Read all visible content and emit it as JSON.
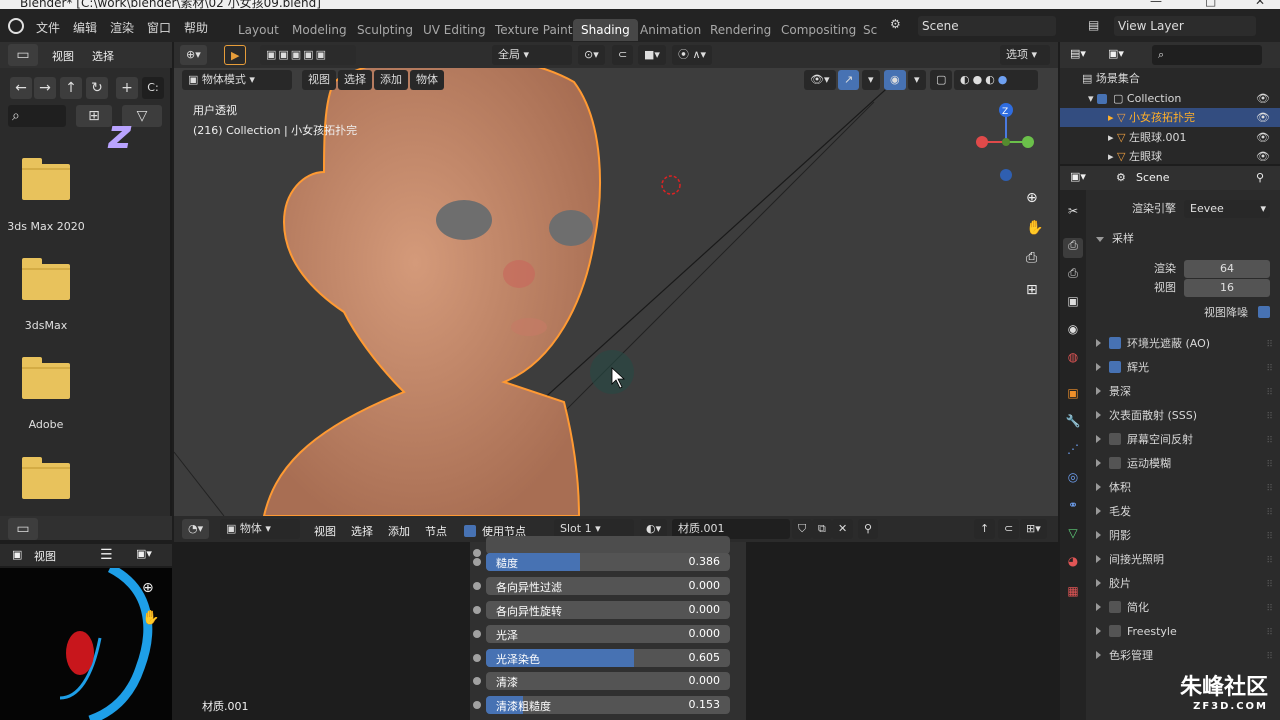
{
  "window": {
    "title": "Blender* [C:\\work\\blender\\素材\\02 小女孩09.blend]"
  },
  "menu": {
    "items": [
      "文件",
      "编辑",
      "渲染",
      "窗口",
      "帮助"
    ]
  },
  "workspaces": {
    "tabs": [
      "Layout",
      "Modeling",
      "Sculpting",
      "UV Editing",
      "Texture Paint",
      "Shading",
      "Animation",
      "Rendering",
      "Compositing",
      "Sc"
    ],
    "active": "Shading"
  },
  "scene": {
    "name": "Scene",
    "view_layer": "View Layer"
  },
  "file_browser": {
    "header_items": [
      "视图",
      "选择"
    ],
    "path_prefix": "C:",
    "folders": [
      "3ds Max 2020",
      "3dsMax",
      "Adobe"
    ]
  },
  "viewport": {
    "transform_orientation": "全局",
    "options_label": "选项",
    "mode": "物体模式",
    "menu": [
      "视图",
      "选择",
      "添加",
      "物体"
    ],
    "overlay_title": "用户透视",
    "overlay_subtitle": "(216) Collection | 小女孩拓扑完",
    "axis": {
      "x": "X",
      "y": "Y",
      "z": "Z"
    }
  },
  "image_editor": {
    "view_label": "视图"
  },
  "node_editor": {
    "object_label": "物体",
    "menu": [
      "视图",
      "选择",
      "添加",
      "节点"
    ],
    "use_nodes_label": "使用节点",
    "slot": "Slot 1",
    "material": "材质.001",
    "footer_material": "材质.001",
    "sliders": [
      {
        "label": "糙度",
        "value": "0.386",
        "fill": 0.386
      },
      {
        "label": "各向异性过滤",
        "value": "0.000",
        "fill": 0
      },
      {
        "label": "各向异性旋转",
        "value": "0.000",
        "fill": 0
      },
      {
        "label": "光泽",
        "value": "0.000",
        "fill": 0
      },
      {
        "label": "光泽染色",
        "value": "0.605",
        "fill": 0.605
      },
      {
        "label": "清漆",
        "value": "0.000",
        "fill": 0
      },
      {
        "label": "清漆粗糙度",
        "value": "0.153",
        "fill": 0.153
      }
    ]
  },
  "outliner": {
    "root": "场景集合",
    "collection": "Collection",
    "items": [
      "小女孩拓扑完",
      "左眼球.001",
      "左眼球"
    ]
  },
  "properties": {
    "context": "Scene",
    "render_engine_label": "渲染引擎",
    "render_engine": "Eevee",
    "sampling_label": "采样",
    "render_samples_label": "渲染",
    "render_samples": "64",
    "viewport_samples_label": "视图",
    "viewport_samples": "16",
    "viewport_denoise_label": "视图降噪",
    "panels": [
      {
        "label": "环境光遮蔽 (AO)",
        "checkbox": true
      },
      {
        "label": "辉光",
        "checkbox": true
      },
      {
        "label": "景深",
        "checkbox": null
      },
      {
        "label": "次表面散射 (SSS)",
        "checkbox": null
      },
      {
        "label": "屏幕空间反射",
        "checkbox": false
      },
      {
        "label": "运动模糊",
        "checkbox": false
      },
      {
        "label": "体积",
        "checkbox": null
      },
      {
        "label": "毛发",
        "checkbox": null
      },
      {
        "label": "阴影",
        "checkbox": null
      },
      {
        "label": "间接光照明",
        "checkbox": null
      },
      {
        "label": "胶片",
        "checkbox": null
      },
      {
        "label": "简化",
        "checkbox": false
      },
      {
        "label": "Freestyle",
        "checkbox": false
      },
      {
        "label": "色彩管理",
        "checkbox": null
      }
    ]
  },
  "watermark": {
    "text": "朱峰社区",
    "url": "ZF3D.COM"
  },
  "colors": {
    "accent": "#4772b3",
    "selection": "#ffaf29",
    "folder": "#e8c25c"
  }
}
